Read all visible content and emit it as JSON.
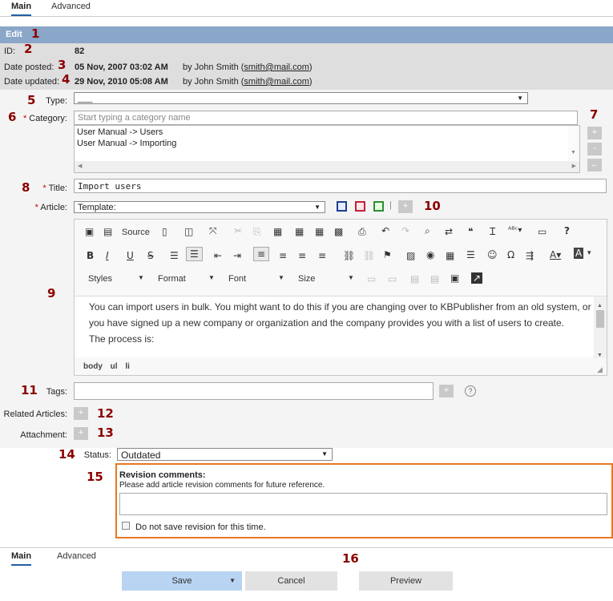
{
  "top_tabs": {
    "main": "Main",
    "advanced": "Advanced"
  },
  "edit_header": "Edit",
  "numbers": [
    "1",
    "2",
    "3",
    "4",
    "5",
    "6",
    "7",
    "8",
    "9",
    "10",
    "11",
    "12",
    "13",
    "14",
    "15",
    "16"
  ],
  "info": {
    "id_label": "ID:",
    "id_value": "82",
    "posted_label": "Date posted:",
    "posted_value": "05 Nov, 2007 03:02 AM",
    "posted_by": "by John Smith (",
    "posted_email": "smith@mail.com",
    "close_paren": ")",
    "updated_label": "Date updated:",
    "updated_value": "29 Nov, 2010 05:08 AM",
    "updated_by": "by John Smith (",
    "updated_email": "smith@mail.com"
  },
  "form": {
    "type_label": "Type:",
    "type_value": "___",
    "category_label": "Category:",
    "category_placeholder": "Start typing a category name",
    "categories": [
      "User Manual -> Users",
      "User Manual -> Importing"
    ],
    "cat_buttons": [
      "+",
      "-",
      "←"
    ],
    "title_label": "Title:",
    "title_value": "Import users",
    "article_label": "Article:",
    "article_template": "Template:",
    "plus": "+"
  },
  "editor": {
    "source_label": "Source",
    "styles": "Styles",
    "format": "Format",
    "font": "Font",
    "size": "Size",
    "content_lines": [
      "You can import users in bulk. You might want to do this if you are changing over to KBPublisher from an old system, or if",
      "you have signed up a new company or organization and the company provides you with a list of users to create.",
      "The process is:"
    ],
    "path": [
      "body",
      "ul",
      "li"
    ]
  },
  "tags_label": "Tags:",
  "help_glyph": "?",
  "related_label": "Related Articles:",
  "attachment_label": "Attachment:",
  "status_label": "Status:",
  "status_value": "Outdated",
  "revision": {
    "title": "Revision comments:",
    "hint": "Please add article revision comments for future reference.",
    "checkbox_label": "Do not save revision for this time."
  },
  "bottom_tabs": {
    "main": "Main",
    "advanced": "Advanced"
  },
  "buttons": {
    "save": "Save",
    "cancel": "Cancel",
    "preview": "Preview"
  },
  "colors": {
    "header_bar": "#8aa6c8",
    "info_bg": "#dedede",
    "form_bg": "#f4f4f4",
    "accent_num": "#8b0000",
    "revision_border": "#e87722",
    "save_bg": "#b9d3f2"
  }
}
